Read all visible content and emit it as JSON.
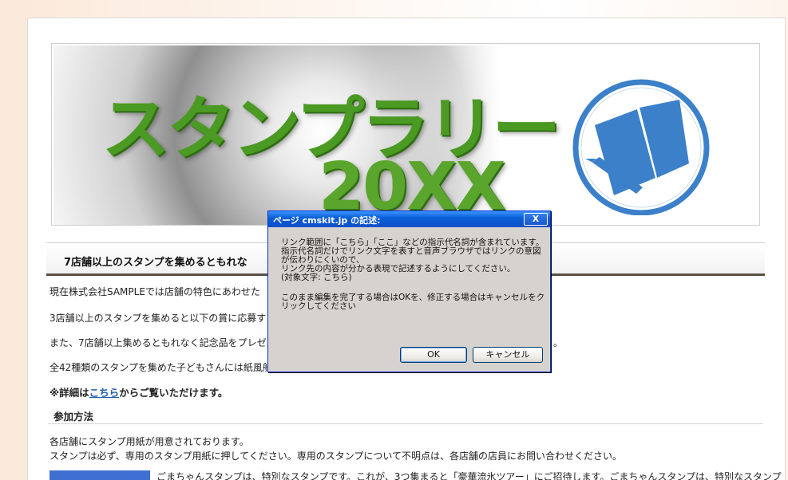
{
  "banner": {
    "title": "スタンプラリー",
    "year": "20XX",
    "logo_icon": "book-pencil-icon"
  },
  "content": {
    "section_title": "7店舗以上のスタンプを集めるともれな",
    "paragraphs": [
      "現在株式会社SAMPLEでは店舗の特色にあわせた",
      "3店舗以上のスタンプを集めると以下の賞に応募す",
      "また、7店舗以上集めるともれなく記念品をプレゼン",
      "全42種類のスタンプを集めた子どもさんには紙風船"
    ],
    "p3_tail": "。",
    "detail": {
      "prefix": "※詳細は",
      "link": "こちら",
      "suffix": "からご覧いただけます。"
    },
    "sub_heading": "参加方法",
    "howto": [
      "各店舗にスタンプ用紙が用意されております。",
      "スタンプは必ず、専用のスタンプ用紙に押してください。専用のスタンプについて不明点は、各店舗の店員にお問い合わせください。"
    ],
    "bottom_text": "ごまちゃんスタンプは、特別なスタンプです。これが、3つ集まると「豪華流氷ツアー」にご招待します。ごまちゃんスタンプは、特別なスタンプ"
  },
  "dialog": {
    "title": "ページ cmskit.jp の記述:",
    "close_label": "X",
    "message_lines": [
      "リンク範囲に「こちら」「ここ」などの指示代名詞が含まれています。",
      "指示代名詞だけでリンク文字を表すと音声ブラウザではリンクの意図",
      "が伝わりにくいので、",
      "リンク先の内容が分かる表現で記述するようにしてください。",
      "(対象文字: こちら)"
    ],
    "confirm_lines": [
      "このまま編集を完了する場合はOKを、修正する場合はキャンセルをク",
      "リックしてください"
    ],
    "ok_label": "OK",
    "cancel_label": "キャンセル"
  },
  "colors": {
    "title_green": "#4b9a23",
    "logo_blue": "#3b80c9",
    "link_blue": "#1f5fae",
    "titlebar_blue": "#0a5fd8"
  }
}
